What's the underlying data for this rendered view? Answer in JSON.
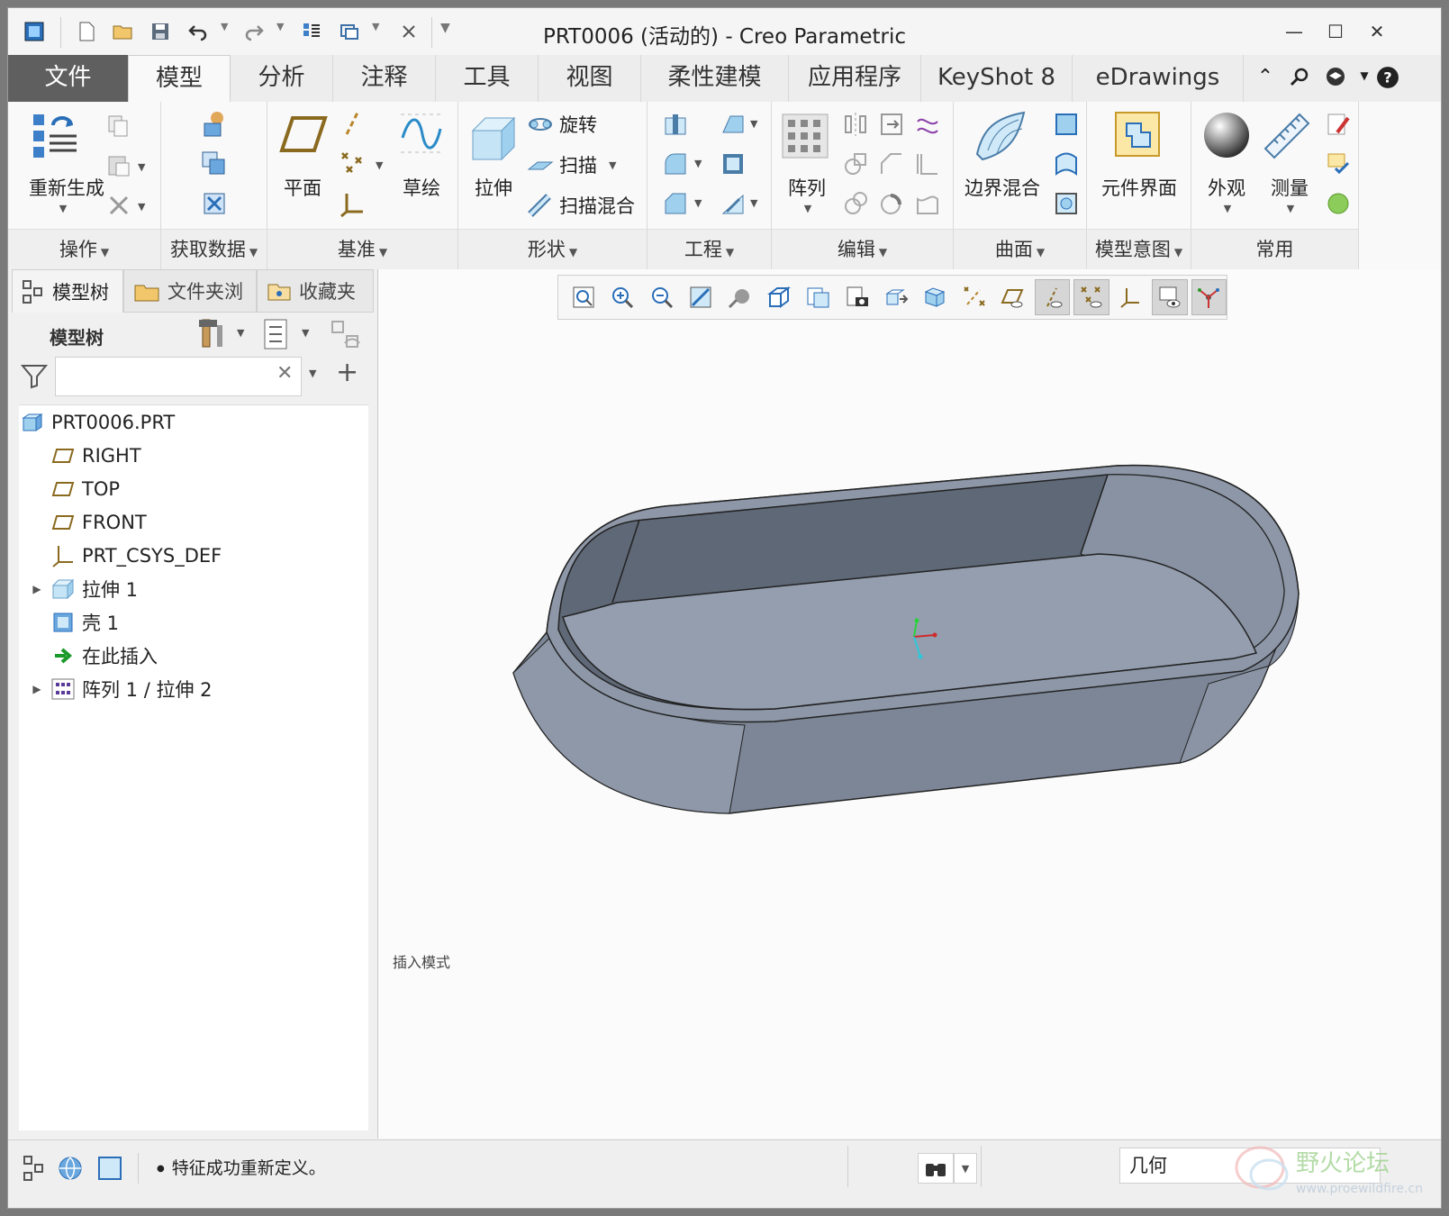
{
  "window": {
    "title": "PRT0006 (活动的) - Creo Parametric"
  },
  "tabs": [
    {
      "label": "文件"
    },
    {
      "label": "模型"
    },
    {
      "label": "分析"
    },
    {
      "label": "注释"
    },
    {
      "label": "工具"
    },
    {
      "label": "视图"
    },
    {
      "label": "柔性建模"
    },
    {
      "label": "应用程序"
    },
    {
      "label": "KeyShot 8"
    },
    {
      "label": "eDrawings"
    }
  ],
  "ribbon": {
    "operations": {
      "regenerate": "重新生成",
      "group": "操作"
    },
    "get_data": {
      "group": "获取数据"
    },
    "datum": {
      "plane": "平面",
      "sketch": "草绘",
      "group": "基准"
    },
    "shapes": {
      "extrude": "拉伸",
      "revolve": "旋转",
      "sweep": "扫描",
      "swept_blend": "扫描混合",
      "group": "形状"
    },
    "engineering": {
      "group": "工程"
    },
    "editing": {
      "pattern": "阵列",
      "group": "编辑"
    },
    "surfaces": {
      "boundary_blend": "边界混合",
      "group": "曲面"
    },
    "model_intent": {
      "component_interface": "元件界面",
      "group": "模型意图"
    },
    "common": {
      "appearance": "外观",
      "measure": "测量",
      "group": "常用"
    }
  },
  "panel": {
    "tabs": [
      {
        "label": "模型树"
      },
      {
        "label": "文件夹浏"
      },
      {
        "label": "收藏夹"
      }
    ],
    "header": "模型树",
    "search": {
      "value": "",
      "placeholder": ""
    }
  },
  "tree": [
    {
      "label": "PRT0006.PRT",
      "icon": "part-icon"
    },
    {
      "label": "RIGHT",
      "icon": "datum-plane-icon"
    },
    {
      "label": "TOP",
      "icon": "datum-plane-icon"
    },
    {
      "label": "FRONT",
      "icon": "datum-plane-icon"
    },
    {
      "label": "PRT_CSYS_DEF",
      "icon": "csys-icon"
    },
    {
      "label": "拉伸 1",
      "icon": "extrude-icon"
    },
    {
      "label": "壳 1",
      "icon": "shell-icon"
    },
    {
      "label": "在此插入",
      "icon": "insert-here-arrow-icon"
    },
    {
      "label": "阵列 1 / 拉伸 2",
      "icon": "pattern-icon"
    }
  ],
  "graphics": {
    "mode_text": "插入模式"
  },
  "status": {
    "message": "特征成功重新定义。",
    "filter": "几何"
  },
  "colors": {
    "accent": "#5f5f5f",
    "model_fill": "#7d8797",
    "model_floor": "#949eaf"
  }
}
